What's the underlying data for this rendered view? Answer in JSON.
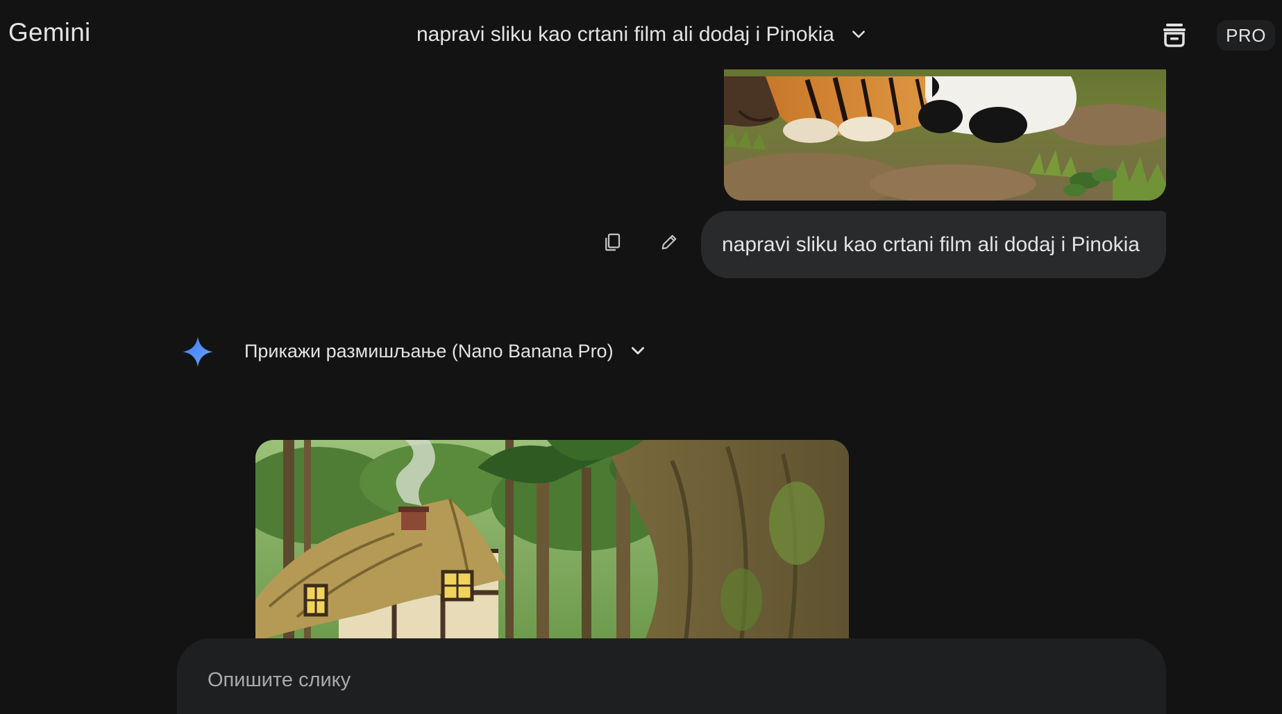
{
  "header": {
    "brand": "Gemini",
    "conversation_title": "napravi sliku kao crtani film ali dodaj i Pinokia",
    "title_dropdown_icon": "chevron-down-icon",
    "temporary_chat_icon": "temporary-chat-icon",
    "plan_badge": "PRO"
  },
  "user_turn": {
    "image_description_icon": "uploaded-photo",
    "prompt_text": "napravi sliku kao crtani film ali dodaj i Pinokia",
    "copy_icon": "copy-icon",
    "edit_icon": "edit-icon"
  },
  "model_turn": {
    "logo_icon": "gemini-spark-icon",
    "thinking_label": "Прикажи размишљање (Nano Banana Pro)",
    "thinking_toggle_icon": "chevron-down-icon",
    "generated_image_icon": "generated-image"
  },
  "composer": {
    "placeholder": "Опишите слику",
    "value": ""
  },
  "colors": {
    "background": "#131314",
    "bubble": "#282a2c",
    "composer": "#1e1f20",
    "text": "#e3e3e3",
    "placeholder": "#a8abae",
    "spark_blue": "#4c8df6"
  }
}
